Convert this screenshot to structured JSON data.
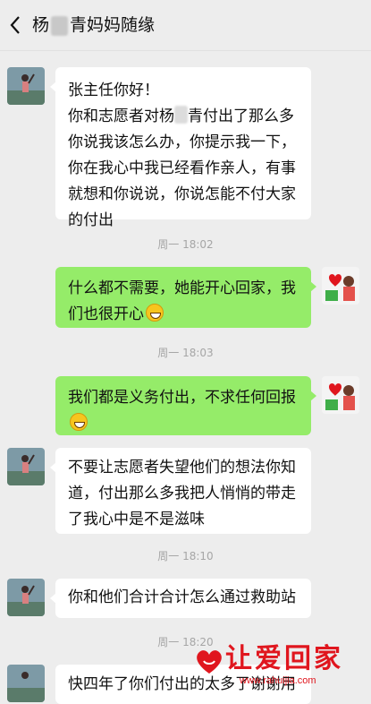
{
  "header": {
    "title_part1": "杨",
    "title_part2": "青妈妈随缘",
    "back_icon": "chevron-left-icon"
  },
  "messages": [
    {
      "side": "left",
      "lines": [
        "张主任你好！",
        "你和志愿者对杨",
        "青付出了那么多",
        "你说我该怎么办，你提示我一下，",
        "你在我心中我已经看作亲人，有事",
        "就想和你说说，你说怎能不付大家",
        "的付出"
      ]
    },
    {
      "side": "right",
      "text": "什么都不需要，她能开心回家，我们也很开心"
    },
    {
      "side": "right",
      "text": "我们都是义务付出，不求任何回报"
    },
    {
      "side": "left",
      "text": "不要让志愿者失望他们的想法你知道，付出那么多我把人悄悄的带走了我心中是不是滋味"
    },
    {
      "side": "left",
      "text": "你和他们合计合计怎么通过救助站"
    },
    {
      "side": "left",
      "text": "快四年了你们付出的太多了谢谢用"
    }
  ],
  "timestamps": [
    "周一 18:02",
    "周一 18:03",
    "周一 18:10",
    "周一 18:20"
  ],
  "watermark": {
    "text": "让爱回家",
    "url": "www.rahuijia.com",
    "icon": "heart-hands-icon"
  },
  "colors": {
    "bg": "#ededed",
    "bubble_left": "#ffffff",
    "bubble_right": "#95ec69",
    "watermark": "#e0161e"
  }
}
